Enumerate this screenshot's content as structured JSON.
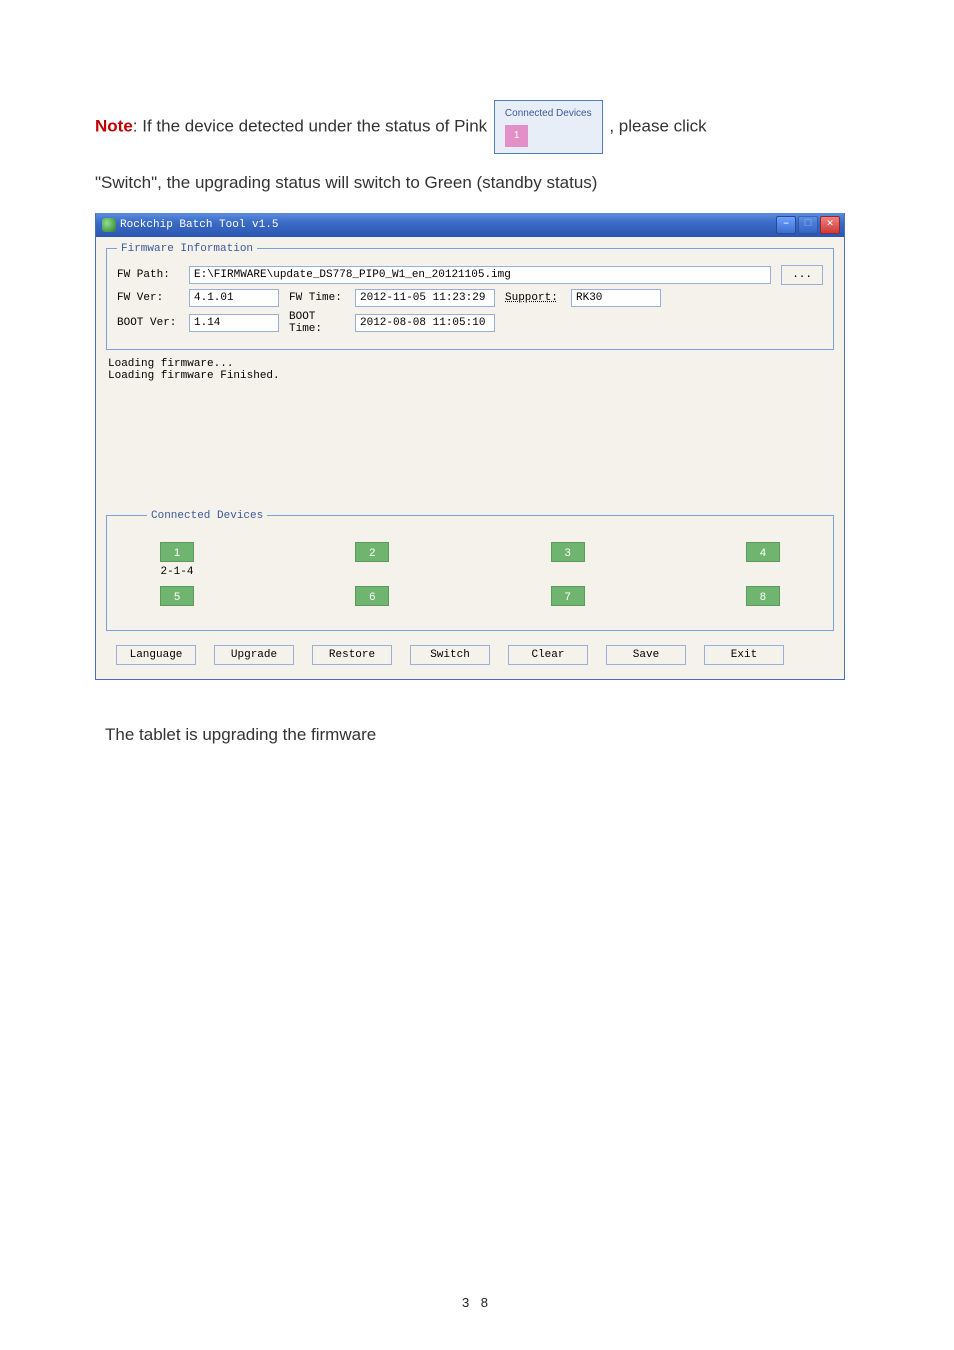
{
  "paragraphs": {
    "note_prefix": "Note",
    "note_text": ": If the device detected under the status of Pink",
    "note_suffix": ", please click",
    "switch_line": "\"Switch\", the upgrading status will switch to Green (standby status)",
    "upgrading_line": "The tablet is upgrading the firmware"
  },
  "inline_badge": {
    "title": "Connected Devices",
    "num": "1"
  },
  "window": {
    "title": "Rockchip Batch Tool v1.5",
    "min": "–",
    "max": "□",
    "close": "✕",
    "fw_legend": "Firmware Information",
    "labels": {
      "fw_path": "FW Path:",
      "fw_ver": "FW Ver:",
      "fw_time": "FW Time:",
      "support": "Support:",
      "boot_ver": "BOOT Ver:",
      "boot_time": "BOOT Time:"
    },
    "values": {
      "path": "E:\\FIRMWARE\\update_DS778_PIP0_W1_en_20121105.img",
      "fw_ver": "4.1.01",
      "fw_time": "2012-11-05 11:23:29",
      "support": "RK30",
      "boot_ver": "1.14",
      "boot_time": "2012-08-08 11:05:10"
    },
    "browse": "...",
    "log": "Loading firmware...\nLoading firmware Finished.",
    "devs_legend": "Connected Devices",
    "slots": [
      "1",
      "2",
      "3",
      "4",
      "5",
      "6",
      "7",
      "8"
    ],
    "slot1_status": "2-1-4",
    "buttons": {
      "language": "Language",
      "upgrade": "Upgrade",
      "restore": "Restore",
      "switch": "Switch",
      "clear": "Clear",
      "save": "Save",
      "exit": "Exit"
    }
  },
  "page_number": "3 8"
}
